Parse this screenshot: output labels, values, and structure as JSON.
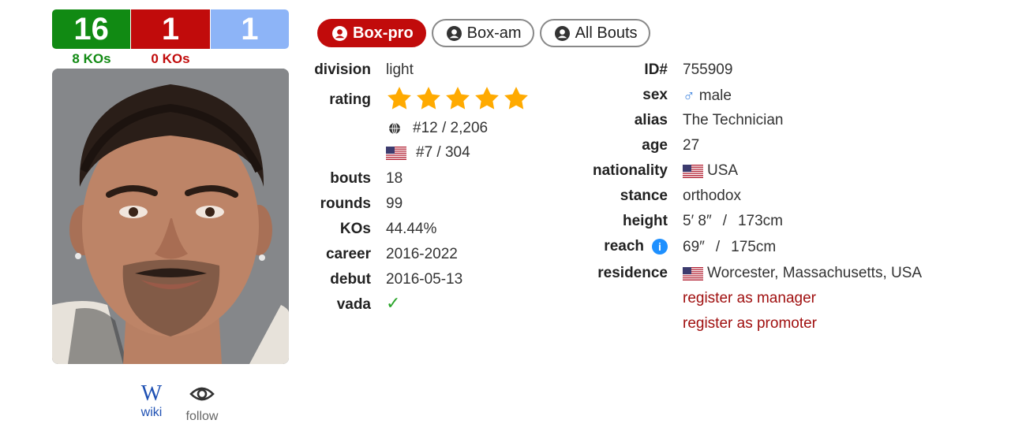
{
  "record": {
    "wins": "16",
    "losses": "1",
    "draws": "1",
    "win_kos": "8 KOs",
    "loss_kos": "0 KOs"
  },
  "colors": {
    "win": "#118a13",
    "loss": "#c10b0b",
    "draw": "#8db4f7",
    "link": "#a01010",
    "info": "#1e90ff"
  },
  "tabs": [
    {
      "label": "Box-pro",
      "active": true,
      "icon": "user-circle-icon"
    },
    {
      "label": "Box-am",
      "active": false,
      "icon": "user-circle-icon"
    },
    {
      "label": "All Bouts",
      "active": false,
      "icon": "user-circle-icon"
    }
  ],
  "bottom": {
    "wiki_label": "wiki",
    "wiki_glyph": "W",
    "follow_label": "follow"
  },
  "left": {
    "division": {
      "label": "division",
      "value": "light"
    },
    "rating": {
      "label": "rating",
      "stars": 5
    },
    "world_rank": "#12 / 2,206",
    "country_rank": "#7 / 304",
    "bouts": {
      "label": "bouts",
      "value": "18"
    },
    "rounds": {
      "label": "rounds",
      "value": "99"
    },
    "kos": {
      "label": "KOs",
      "value": "44.44%"
    },
    "career": {
      "label": "career",
      "value": "2016-2022"
    },
    "debut": {
      "label": "debut",
      "value": "2016-05-13"
    },
    "vada": {
      "label": "vada",
      "value": "✓"
    }
  },
  "right": {
    "id": {
      "label": "ID#",
      "value": "755909"
    },
    "sex": {
      "label": "sex",
      "value": "male",
      "symbol": "♂"
    },
    "alias": {
      "label": "alias",
      "value": "The Technician"
    },
    "age": {
      "label": "age",
      "value": "27"
    },
    "nationality": {
      "label": "nationality",
      "value": "USA"
    },
    "stance": {
      "label": "stance",
      "value": "orthodox"
    },
    "height": {
      "label": "height",
      "imperial": "5′ 8″",
      "metric": "173cm",
      "sep": "/"
    },
    "reach": {
      "label": "reach",
      "imperial": "69″",
      "metric": "175cm",
      "sep": "/",
      "info": "i"
    },
    "residence": {
      "label": "residence",
      "value": "Worcester, Massachusetts, USA"
    },
    "register_manager": "register as manager",
    "register_promoter": "register as promoter"
  }
}
